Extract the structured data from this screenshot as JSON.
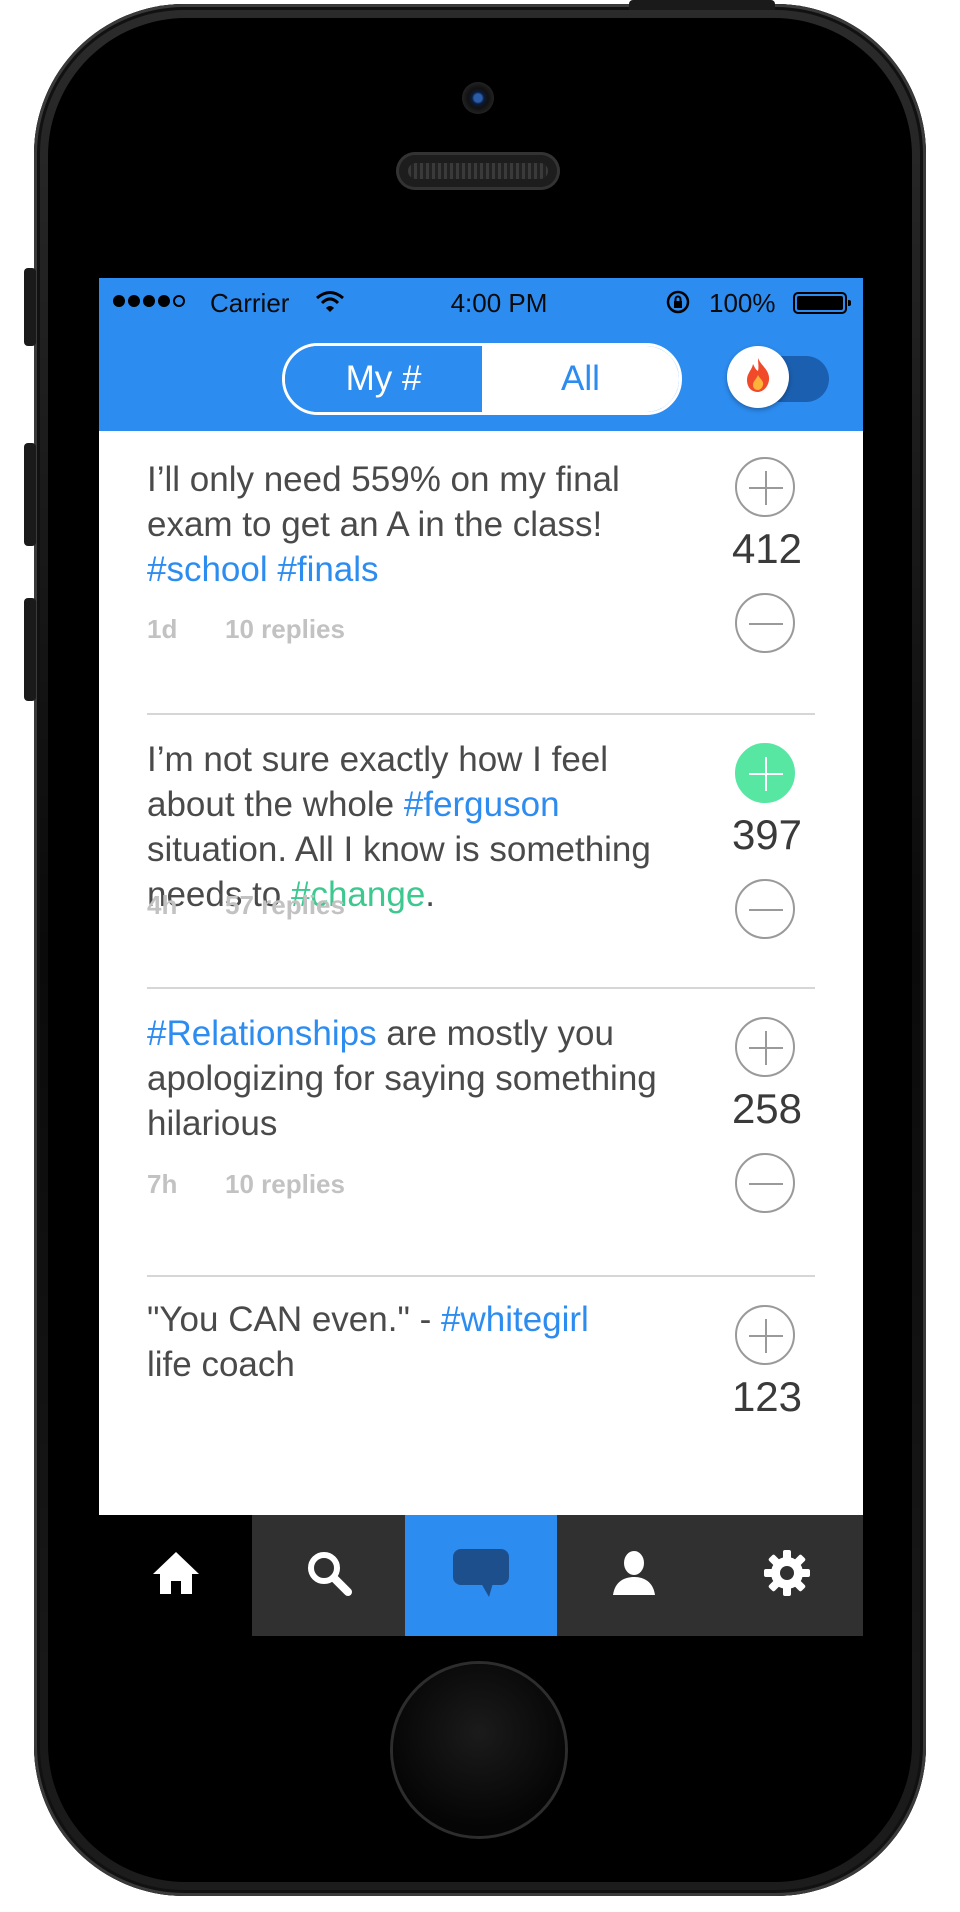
{
  "status_bar": {
    "carrier": "Carrier",
    "time": "4:00 PM",
    "battery": "100%"
  },
  "header": {
    "segments": [
      "My #",
      "All"
    ],
    "selected_segment": "All",
    "hot_toggle_icon": "flame-icon"
  },
  "posts": [
    {
      "text_parts": [
        {
          "text": "I’ll only need 559% on my final exam to get an A in the class! ",
          "style": "plain"
        },
        {
          "text": "#school",
          "style": "blue"
        },
        {
          "text": " ",
          "style": "plain"
        },
        {
          "text": "#finals",
          "style": "blue"
        }
      ],
      "score": "412",
      "age": "1d",
      "replies": "10 replies",
      "upvoted": false
    },
    {
      "text_parts": [
        {
          "text": "I’m not sure exactly how I feel about the whole ",
          "style": "plain"
        },
        {
          "text": "#ferguson",
          "style": "blue"
        },
        {
          "text": " situation. All I know is something needs to ",
          "style": "plain"
        },
        {
          "text": "#change",
          "style": "green"
        },
        {
          "text": ".",
          "style": "plain"
        }
      ],
      "score": "397",
      "age": "4h",
      "replies": "57 replies",
      "upvoted": true
    },
    {
      "text_parts": [
        {
          "text": "#Relationships",
          "style": "blue"
        },
        {
          "text": " are mostly you apologizing for saying something hilarious",
          "style": "plain"
        }
      ],
      "score": "258",
      "age": "7h",
      "replies": "10 replies",
      "upvoted": false
    },
    {
      "text_parts": [
        {
          "text": "\"You CAN even.\" - ",
          "style": "plain"
        },
        {
          "text": "#whitegirl",
          "style": "blue"
        },
        {
          "text": " life coach",
          "style": "plain"
        }
      ],
      "score": "123",
      "age": "",
      "replies": "",
      "upvoted": false
    }
  ],
  "tabbar": {
    "tabs": [
      {
        "icon": "home-icon"
      },
      {
        "icon": "search-icon"
      },
      {
        "icon": "chat-bubble-icon"
      },
      {
        "icon": "profile-icon"
      },
      {
        "icon": "gear-icon"
      }
    ],
    "active_tab": "chat-bubble-icon"
  },
  "colors": {
    "accent_blue": "#2d8cf0",
    "hashtag_green": "#3cc88e",
    "upvote_active": "#58e6a3",
    "tabbar_dark": "#303030"
  }
}
